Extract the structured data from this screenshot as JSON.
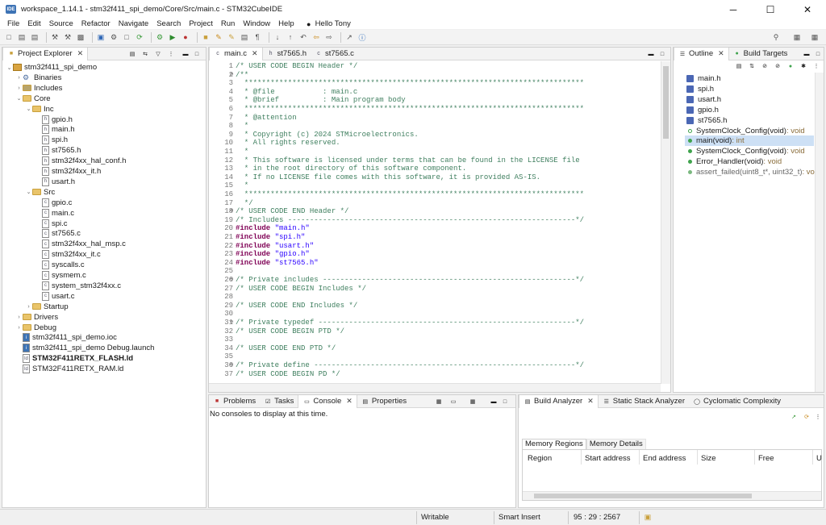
{
  "window": {
    "title": "workspace_1.14.1 - stm32f411_spi_demo/Core/Src/main.c - STM32CubeIDE",
    "app_icon_text": "IDE",
    "minimize": "─",
    "maximize": "☐",
    "close": "✕"
  },
  "menu": [
    "File",
    "Edit",
    "Source",
    "Refactor",
    "Navigate",
    "Search",
    "Project",
    "Run",
    "Window",
    "Help"
  ],
  "user": "Hello Tony",
  "project_explorer": {
    "title": "Project Explorer",
    "items": [
      {
        "label": "stm32f411_spi_demo",
        "kind": "project",
        "depth": 0,
        "expanded": true
      },
      {
        "label": "Binaries",
        "kind": "binaries",
        "depth": 1,
        "expanded": false
      },
      {
        "label": "Includes",
        "kind": "includes",
        "depth": 1,
        "expanded": false
      },
      {
        "label": "Core",
        "kind": "folder",
        "depth": 1,
        "expanded": true
      },
      {
        "label": "Inc",
        "kind": "folder",
        "depth": 2,
        "expanded": true
      },
      {
        "label": "gpio.h",
        "kind": "h",
        "depth": 3
      },
      {
        "label": "main.h",
        "kind": "h",
        "depth": 3
      },
      {
        "label": "spi.h",
        "kind": "h",
        "depth": 3
      },
      {
        "label": "st7565.h",
        "kind": "h",
        "depth": 3
      },
      {
        "label": "stm32f4xx_hal_conf.h",
        "kind": "h",
        "depth": 3
      },
      {
        "label": "stm32f4xx_it.h",
        "kind": "h",
        "depth": 3
      },
      {
        "label": "usart.h",
        "kind": "h",
        "depth": 3
      },
      {
        "label": "Src",
        "kind": "folder",
        "depth": 2,
        "expanded": true
      },
      {
        "label": "gpio.c",
        "kind": "c",
        "depth": 3
      },
      {
        "label": "main.c",
        "kind": "c",
        "depth": 3
      },
      {
        "label": "spi.c",
        "kind": "c",
        "depth": 3
      },
      {
        "label": "st7565.c",
        "kind": "c",
        "depth": 3
      },
      {
        "label": "stm32f4xx_hal_msp.c",
        "kind": "c",
        "depth": 3
      },
      {
        "label": "stm32f4xx_it.c",
        "kind": "c",
        "depth": 3
      },
      {
        "label": "syscalls.c",
        "kind": "c",
        "depth": 3
      },
      {
        "label": "sysmem.c",
        "kind": "c",
        "depth": 3
      },
      {
        "label": "system_stm32f4xx.c",
        "kind": "c",
        "depth": 3
      },
      {
        "label": "usart.c",
        "kind": "c",
        "depth": 3
      },
      {
        "label": "Startup",
        "kind": "folder",
        "depth": 2,
        "expanded": false
      },
      {
        "label": "Drivers",
        "kind": "folder",
        "depth": 1,
        "expanded": false
      },
      {
        "label": "Debug",
        "kind": "folder",
        "depth": 1,
        "expanded": false
      },
      {
        "label": "stm32f411_spi_demo.ioc",
        "kind": "file",
        "depth": 1
      },
      {
        "label": "stm32f411_spi_demo Debug.launch",
        "kind": "file",
        "depth": 1
      },
      {
        "label": "STM32F411RETX_FLASH.ld",
        "kind": "ld",
        "depth": 1,
        "bold": true
      },
      {
        "label": "STM32F411RETX_RAM.ld",
        "kind": "ld",
        "depth": 1
      }
    ]
  },
  "editor": {
    "tabs": [
      {
        "label": "main.c",
        "active": true
      },
      {
        "label": "st7565.h",
        "active": false
      },
      {
        "label": "st7565.c",
        "active": false
      }
    ],
    "lines": [
      {
        "n": "1",
        "t": "/* USER CODE BEGIN Header */"
      },
      {
        "n": "2",
        "t": "/**",
        "fold": true
      },
      {
        "n": "3",
        "t": "  ******************************************************************************"
      },
      {
        "n": "4",
        "t": "  * @file           : main.c"
      },
      {
        "n": "5",
        "t": "  * @brief          : Main program body"
      },
      {
        "n": "6",
        "t": "  ******************************************************************************"
      },
      {
        "n": "7",
        "t": "  * @attention"
      },
      {
        "n": "8",
        "t": "  *"
      },
      {
        "n": "9",
        "t": "  * Copyright (c) 2024 STMicroelectronics."
      },
      {
        "n": "10",
        "t": "  * All rights reserved."
      },
      {
        "n": "11",
        "t": "  *"
      },
      {
        "n": "12",
        "t": "  * This software is licensed under terms that can be found in the LICENSE file"
      },
      {
        "n": "13",
        "t": "  * in the root directory of this software component."
      },
      {
        "n": "14",
        "t": "  * If no LICENSE file comes with this software, it is provided AS-IS."
      },
      {
        "n": "15",
        "t": "  *"
      },
      {
        "n": "16",
        "t": "  ******************************************************************************"
      },
      {
        "n": "17",
        "t": "  */"
      },
      {
        "n": "18",
        "t": "/* USER CODE END Header */",
        "fold": true
      },
      {
        "n": "19",
        "t": "/* Includes ------------------------------------------------------------------*/"
      },
      {
        "n": "20",
        "t": "#include ",
        "s": "\"main.h\"",
        "inc": true
      },
      {
        "n": "21",
        "t": "#include ",
        "s": "\"spi.h\"",
        "inc": true
      },
      {
        "n": "22",
        "t": "#include ",
        "s": "\"usart.h\"",
        "inc": true
      },
      {
        "n": "23",
        "t": "#include ",
        "s": "\"gpio.h\"",
        "inc": true
      },
      {
        "n": "24",
        "t": "#include ",
        "s": "\"st7565.h\"",
        "inc": true
      },
      {
        "n": "25",
        "t": ""
      },
      {
        "n": "26",
        "t": "/* Private includes ----------------------------------------------------------*/",
        "fold": true
      },
      {
        "n": "27",
        "t": "/* USER CODE BEGIN Includes */"
      },
      {
        "n": "28",
        "t": ""
      },
      {
        "n": "29",
        "t": "/* USER CODE END Includes */"
      },
      {
        "n": "30",
        "t": ""
      },
      {
        "n": "31",
        "t": "/* Private typedef -----------------------------------------------------------*/",
        "fold": true
      },
      {
        "n": "32",
        "t": "/* USER CODE BEGIN PTD */"
      },
      {
        "n": "33",
        "t": ""
      },
      {
        "n": "34",
        "t": "/* USER CODE END PTD */"
      },
      {
        "n": "35",
        "t": ""
      },
      {
        "n": "36",
        "t": "/* Private define ------------------------------------------------------------*/",
        "fold": true
      },
      {
        "n": "37",
        "t": "/* USER CODE BEGIN PD */"
      }
    ]
  },
  "outline": {
    "tabs": [
      {
        "label": "Outline",
        "active": true
      },
      {
        "label": "Build Targets",
        "active": false
      }
    ],
    "items": [
      {
        "label": "main.h",
        "kind": "include"
      },
      {
        "label": "spi.h",
        "kind": "include"
      },
      {
        "label": "usart.h",
        "kind": "include"
      },
      {
        "label": "gpio.h",
        "kind": "include"
      },
      {
        "label": "st7565.h",
        "kind": "include"
      },
      {
        "label": "SystemClock_Config(void)",
        "type": " : void",
        "kind": "func-decl"
      },
      {
        "label": "main(void)",
        "type": " : int",
        "kind": "func",
        "selected": true
      },
      {
        "label": "SystemClock_Config(void)",
        "type": " : void",
        "kind": "func"
      },
      {
        "label": "Error_Handler(void)",
        "type": " : void",
        "kind": "func"
      },
      {
        "label": "assert_failed(uint8_t*, uint32_t)",
        "type": " : void",
        "kind": "func-gray"
      }
    ]
  },
  "console": {
    "tabs": [
      {
        "label": "Problems",
        "active": false
      },
      {
        "label": "Tasks",
        "active": false
      },
      {
        "label": "Console",
        "active": true
      },
      {
        "label": "Properties",
        "active": false
      }
    ],
    "message": "No consoles to display at this time."
  },
  "build_analyzer": {
    "tabs": [
      {
        "label": "Build Analyzer",
        "active": true
      },
      {
        "label": "Static Stack Analyzer",
        "active": false
      },
      {
        "label": "Cyclomatic Complexity",
        "active": false
      }
    ],
    "subtabs": [
      {
        "label": "Memory Regions",
        "active": true
      },
      {
        "label": "Memory Details",
        "active": false
      }
    ],
    "columns": [
      "Region",
      "Start address",
      "End address",
      "Size",
      "Free",
      "U"
    ]
  },
  "status": {
    "writable": "Writable",
    "insert_mode": "Smart Insert",
    "position": "95 : 29 : 2567"
  },
  "colors": {
    "keyword": "#7f0055",
    "comment": "#3f7f5f",
    "string": "#2a00ff",
    "selection": "#cde0f5"
  }
}
